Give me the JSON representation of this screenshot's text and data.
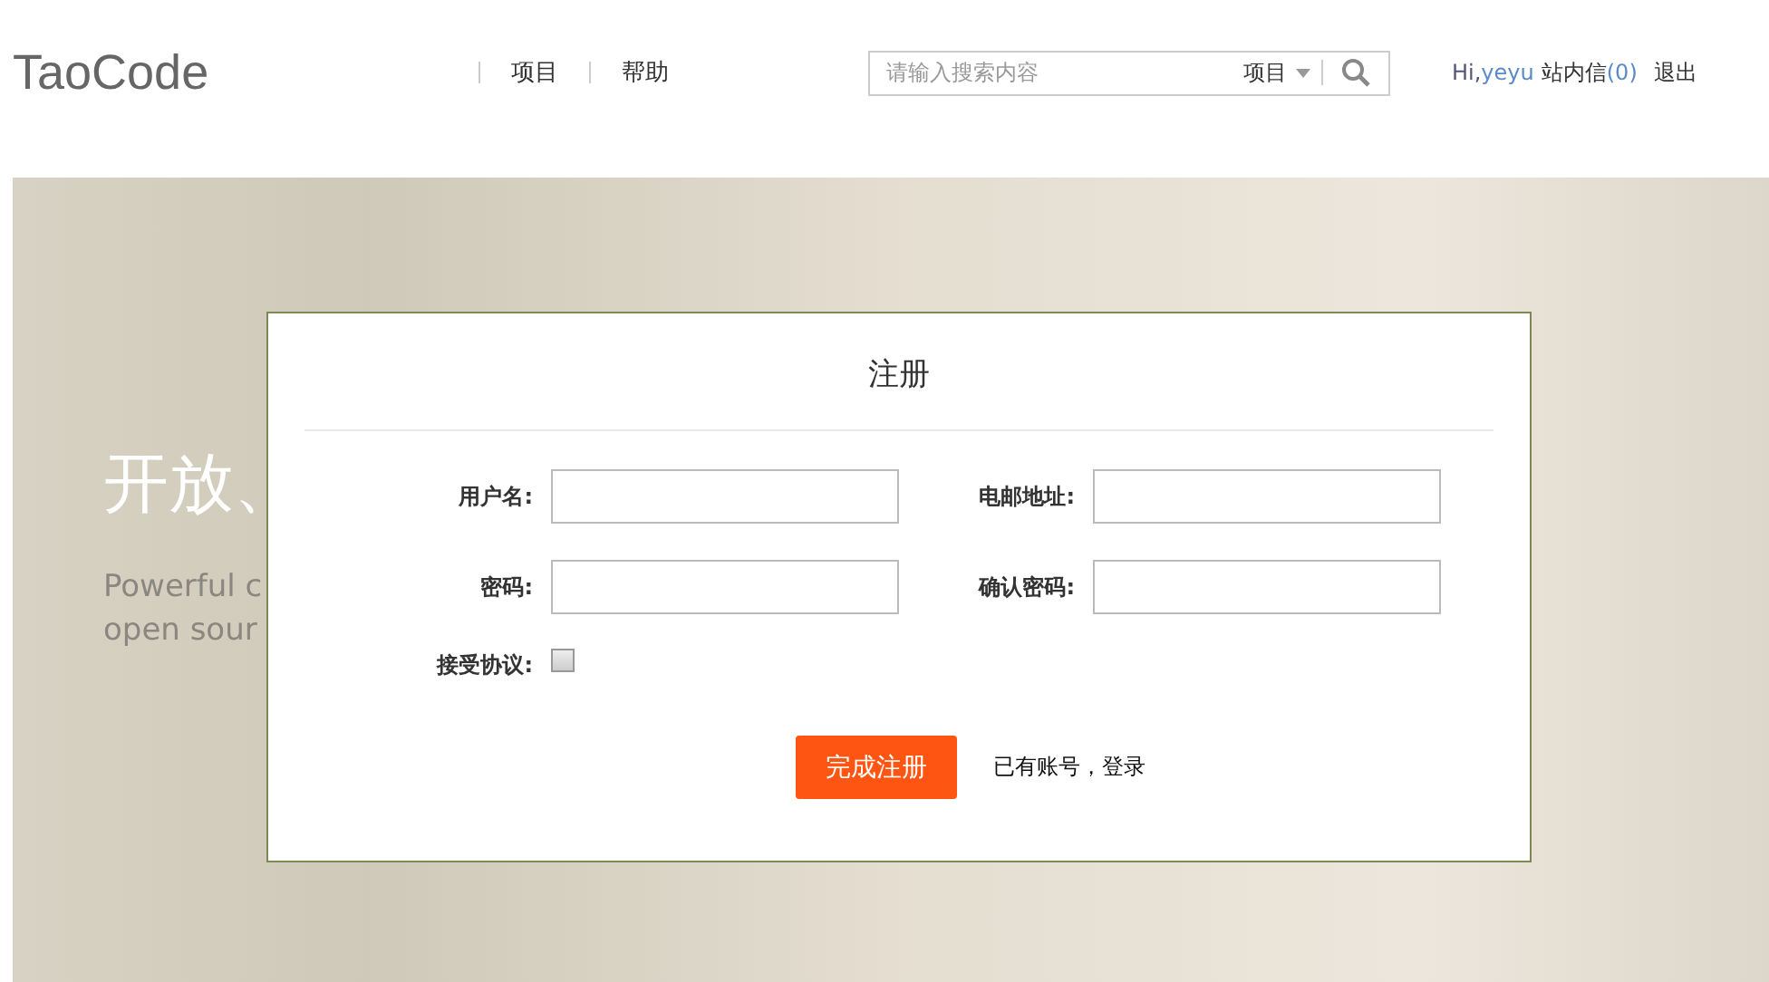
{
  "header": {
    "logo": "TaoCode",
    "nav": [
      "项目",
      "帮助"
    ],
    "search": {
      "placeholder": "请输入搜索内容",
      "scope": "项目"
    },
    "user": {
      "greeting": "Hi,",
      "name": "yeyu",
      "messages": "站内信",
      "message_count": "(0)",
      "logout": "退出"
    }
  },
  "hero": {
    "title": "开放、",
    "lines": [
      "Powerful c",
      "open sour"
    ]
  },
  "dialog": {
    "title": "注册",
    "fields": [
      {
        "label": "用户名:"
      },
      {
        "label": "电邮地址:"
      },
      {
        "label": "密码:"
      },
      {
        "label": "确认密码:"
      }
    ],
    "agreement": {
      "label": "接受协议:",
      "checked": false
    },
    "submit": "完成注册",
    "login_link": "已有账号，登录"
  }
}
